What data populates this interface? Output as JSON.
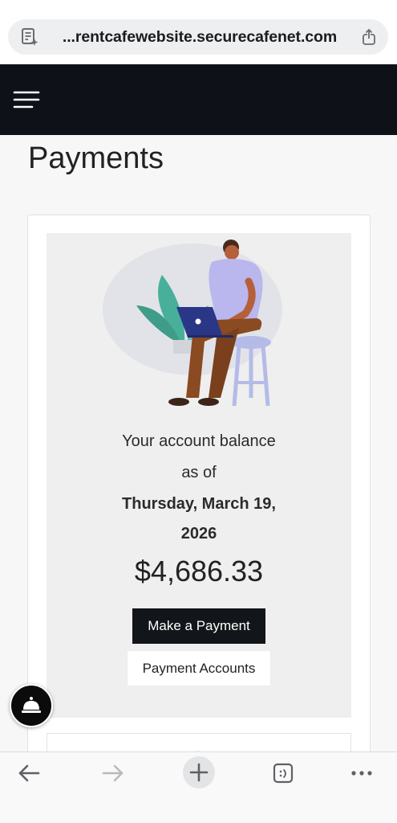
{
  "browser": {
    "url": "...rentcafewebsite.securecafenet.com"
  },
  "page": {
    "title": "Payments"
  },
  "balance": {
    "line1": "Your account balance",
    "line2": "as of",
    "date_line1": "Thursday, March 19,",
    "date_line2": "2026",
    "amount": "$4,686.33"
  },
  "buttons": {
    "make_payment": "Make a Payment",
    "payment_accounts": "Payment Accounts"
  },
  "icons": {
    "doc": "document-sparkle-icon",
    "share": "share-icon",
    "menu": "hamburger-menu-icon",
    "concierge": "concierge-bell-icon",
    "back": "back-arrow-icon",
    "forward": "forward-arrow-icon",
    "new_tab": "plus-icon",
    "tabs": "tabs-icon",
    "more": "more-dots-icon"
  },
  "colors": {
    "header_bg": "#0e1218",
    "primary_button": "#121519",
    "accent_green": "#5cc36b"
  }
}
